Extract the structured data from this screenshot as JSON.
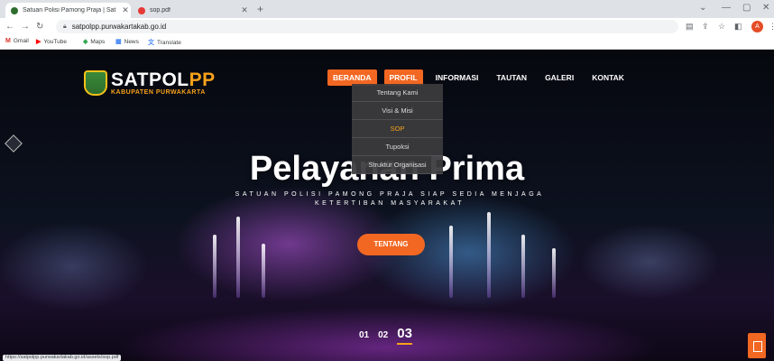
{
  "browser": {
    "tabs": [
      {
        "title": "Satuan Polisi Pamong Praja | Sat",
        "active": true,
        "favicon_color": "#2e6d2e"
      },
      {
        "title": "sop.pdf",
        "active": false,
        "favicon_color": "#e53935"
      }
    ],
    "url": "satpolpp.purwakartakab.go.id",
    "profile_initial": "A",
    "bookmarks": [
      {
        "label": "Gmail",
        "icon": "gmail-icon"
      },
      {
        "label": "YouTube",
        "icon": "youtube-icon"
      },
      {
        "label": "Maps",
        "icon": "maps-icon"
      },
      {
        "label": "News",
        "icon": "news-icon"
      },
      {
        "label": "Translate",
        "icon": "translate-icon"
      }
    ],
    "status_url": "https://satpolpp.purwakartakab.go.id/assets/sop.pdf"
  },
  "site": {
    "brand_main": "SATPOL",
    "brand_accent": "PP",
    "brand_sub": "KABUPATEN PURWAKARTA",
    "menu": [
      "BERANDA",
      "PROFIL",
      "INFORMASI",
      "TAUTAN",
      "GALERI",
      "KONTAK"
    ],
    "dropdown": [
      "Tentang Kami",
      "Visi & Misi",
      "SOP",
      "Tupoksi",
      "Struktur Organisasi"
    ],
    "hero_title": "Pelayanan Prima",
    "hero_subtitle": "SATUAN POLISI PAMONG PRAJA SIAP SEDIA MENJAGA KETERTIBAN MASYARAKAT",
    "cta_label": "TENTANG",
    "slides": [
      "01",
      "02",
      "03"
    ],
    "current_slide": "03",
    "colors": {
      "accent": "#f26722",
      "brand_orange": "#f7a21b",
      "dropdown_selected": "#f7a21b"
    }
  }
}
